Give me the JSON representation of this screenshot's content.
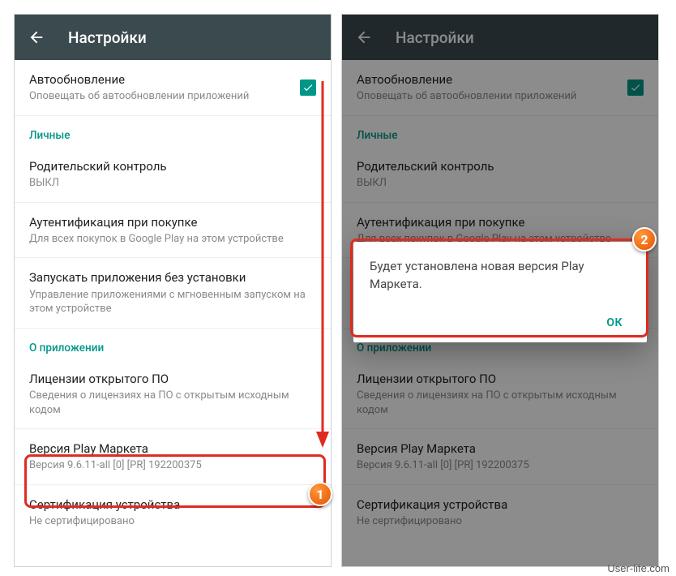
{
  "appbar": {
    "title": "Настройки"
  },
  "settings": {
    "auto_update": {
      "title": "Автообновление",
      "subtitle": "Оповещать об автообновлении приложений",
      "checked": true
    },
    "section_personal": "Личные",
    "parental": {
      "title": "Родительский контроль",
      "subtitle": "ВЫКЛ"
    },
    "auth": {
      "title": "Аутентификация при покупке",
      "subtitle": "Для всех покупок в Google Play на этом устройстве"
    },
    "instant": {
      "title": "Запускать приложения без установки",
      "subtitle": "Управление приложениями с мгновенным запуском на этом устройстве"
    },
    "section_about": "О приложении",
    "licenses": {
      "title": "Лицензии открытого ПО",
      "subtitle": "Сведения о лицензиях на ПО с открытым исходным кодом"
    },
    "version": {
      "title": "Версия Play Маркета",
      "subtitle": "Версия 9.6.11-all [0] [PR] 192200375"
    },
    "cert": {
      "title": "Сертификация устройства",
      "subtitle": "Не сертифицировано"
    }
  },
  "dialog": {
    "message": "Будет установлена новая версия Play Маркета.",
    "ok": "ОК"
  },
  "annotations": {
    "badge1": "1",
    "badge2": "2"
  },
  "watermark": "User-life.com"
}
